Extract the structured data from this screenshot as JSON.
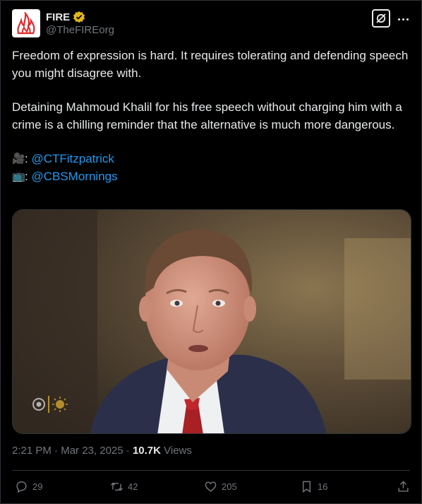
{
  "author": {
    "name": "FIRE",
    "handle": "@TheFIREorg",
    "verified": true,
    "avatar_color": "#e8272b"
  },
  "post": {
    "paragraph1": "Freedom of expression is hard. It requires tolerating and defending speech you might disagree with.",
    "paragraph2": "Detaining Mahmoud Khalil for his free speech without charging him with a crime is a chilling reminder that the alternative is much more dangerous.",
    "credits": [
      {
        "icon": "movie-camera-icon",
        "glyph": "🎥",
        "sep": ":",
        "mention": "@CTFitzpatrick"
      },
      {
        "icon": "television-icon",
        "glyph": "📺",
        "sep": ":",
        "mention": "@CBSMornings"
      }
    ]
  },
  "meta": {
    "time": "2:21 PM",
    "dot1": " · ",
    "date": "Mar 23, 2025",
    "dot2": " · ",
    "views_count": "10.7K",
    "views_label": " Views"
  },
  "actions": {
    "replies": "29",
    "reposts": "42",
    "likes": "205",
    "bookmarks": "16"
  },
  "colors": {
    "background": "#000000",
    "text": "#e7e9ea",
    "secondary": "#71767b",
    "link": "#1d9bf0",
    "verified_badge": "#e2b719"
  }
}
